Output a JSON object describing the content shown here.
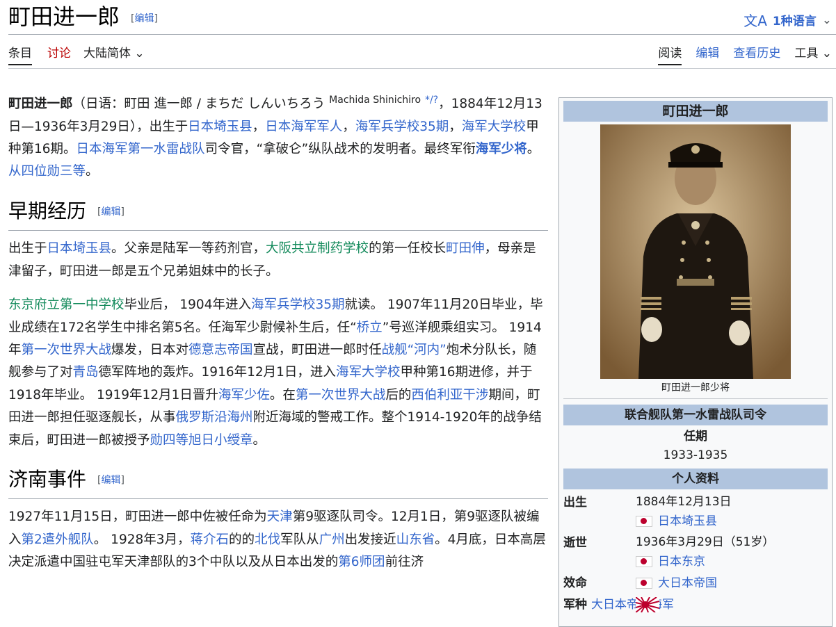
{
  "header": {
    "title": "町田进一郎",
    "edit_label": "编辑",
    "lang_icon": "文A",
    "lang_label": "1种语言"
  },
  "tabs_left": [
    {
      "label": "条目",
      "selected": true
    },
    {
      "label": "讨论"
    },
    {
      "label": "大陆简体"
    }
  ],
  "tabs_right": [
    {
      "label": "阅读",
      "selected": true
    },
    {
      "label": "编辑"
    },
    {
      "label": "查看历史"
    },
    {
      "label": "工具"
    }
  ],
  "intro": {
    "name": "町田进一郎",
    "p1": "（日语：町田 進一郎 / まちだ しんいちろう ",
    "romaji": "Machida Shinichiro",
    "pron": "*/?",
    "p2": "，1884年12月13日—1936年3月29日），出生于",
    "l1": "日本埼玉县",
    "p3": "，",
    "l2": "日本海军军人",
    "p4": "，",
    "l3": "海军兵学校35期",
    "p5": "，",
    "l4": "海军大学校",
    "p6": "甲种第16期。",
    "l5": "日本海军第一水雷战队",
    "p7": "司令官，“拿破仑”纵队战术的发明者。最终军衔",
    "l6": "海军少将",
    "p8": "。",
    "l7": "从四位勋三等",
    "p9": "。"
  },
  "sections": {
    "early": "早期经历",
    "jinan": "济南事件"
  },
  "early_p1": {
    "a": "出生于",
    "l1": "日本埼玉县",
    "b": "。父亲是陆军一等药剂官，",
    "l2": "大阪共立制药学校",
    "c": "的第一任校长",
    "l3": "町田伸",
    "d": "，母亲是津留子，町田进一郎是五个兄弟姐妹中的长子。"
  },
  "early_p2": {
    "l1": "东京府立第一中学校",
    "a": "毕业后， 1904年进入",
    "l2": "海军兵学校35期",
    "b": "就读。 1907年11月20日毕业，毕业成绩在172名学生中排名第5名。任海军少尉候补生后，任“",
    "l3": "桥立",
    "c": "”号巡洋舰乘组实习。 1914年",
    "l4": "第一次世界大战",
    "d": "爆发，日本对",
    "l5": "德意志帝国",
    "e": "宣战，町田进一郎时任",
    "l6": "战舰“河内”",
    "f": "炮术分队长，随舰参与了对",
    "l7": "青岛",
    "g": "德军阵地的轰炸。1916年12月1日，进入",
    "l8": "海军大学校",
    "h": "甲种第16期进修，并于1918年毕业。 1919年12月1日晋升",
    "l9": "海军少佐",
    "i": "。在",
    "l10": "第一次世界大战",
    "j": "后的",
    "l11": "西伯利亚干涉",
    "k": "期间，町田进一郎担任驱逐舰长，从事",
    "l12": "俄罗斯沿海州",
    "m": "附近海域的警戒工作。整个1914-1920年的战争结束后，町田进一郎被授予",
    "l13": "勋四等旭日小绶章",
    "n": "。"
  },
  "jinan_p1": {
    "a": "1927年11月15日，町田进一郎中佐被任命为",
    "l1": "天津",
    "b": "第9驱逐队司令。12月1日，第9驱逐队被编入",
    "l2": "第2遣外舰队",
    "c": "。 1928年3月，",
    "l3": "蒋介石",
    "d": "的的",
    "l4": "北伐",
    "e": "军队从",
    "l5": "广州",
    "f": "出发接近",
    "l6": "山东省",
    "g": "。4月底，日本高层决定派遣中国驻屯军天津部队的3个中队以及从日本出发的",
    "l7": "第6师团",
    "h": "前往济"
  },
  "infobox": {
    "title": "町田进一郎",
    "caption": "町田进一郎少将",
    "office_header": "联合舰队第一水雷战队司令",
    "term_label": "任期",
    "term": "1933-1935",
    "personal_header": "个人资料",
    "born_label": "出生",
    "born_date": "1884年12月13日",
    "born_place": "日本埼玉县",
    "died_label": "逝世",
    "died_date": "1936年3月29日（51岁）",
    "died_place": "日本东京",
    "allegiance_label": "效命",
    "allegiance": "大日本帝国",
    "branch_label": "军种",
    "branch": "大日本帝国海军"
  },
  "colors": {
    "link": "#3366cc",
    "link_green": "#138a5b",
    "talk_red": "#ba0000",
    "infobox_header": "#b0c4de"
  }
}
